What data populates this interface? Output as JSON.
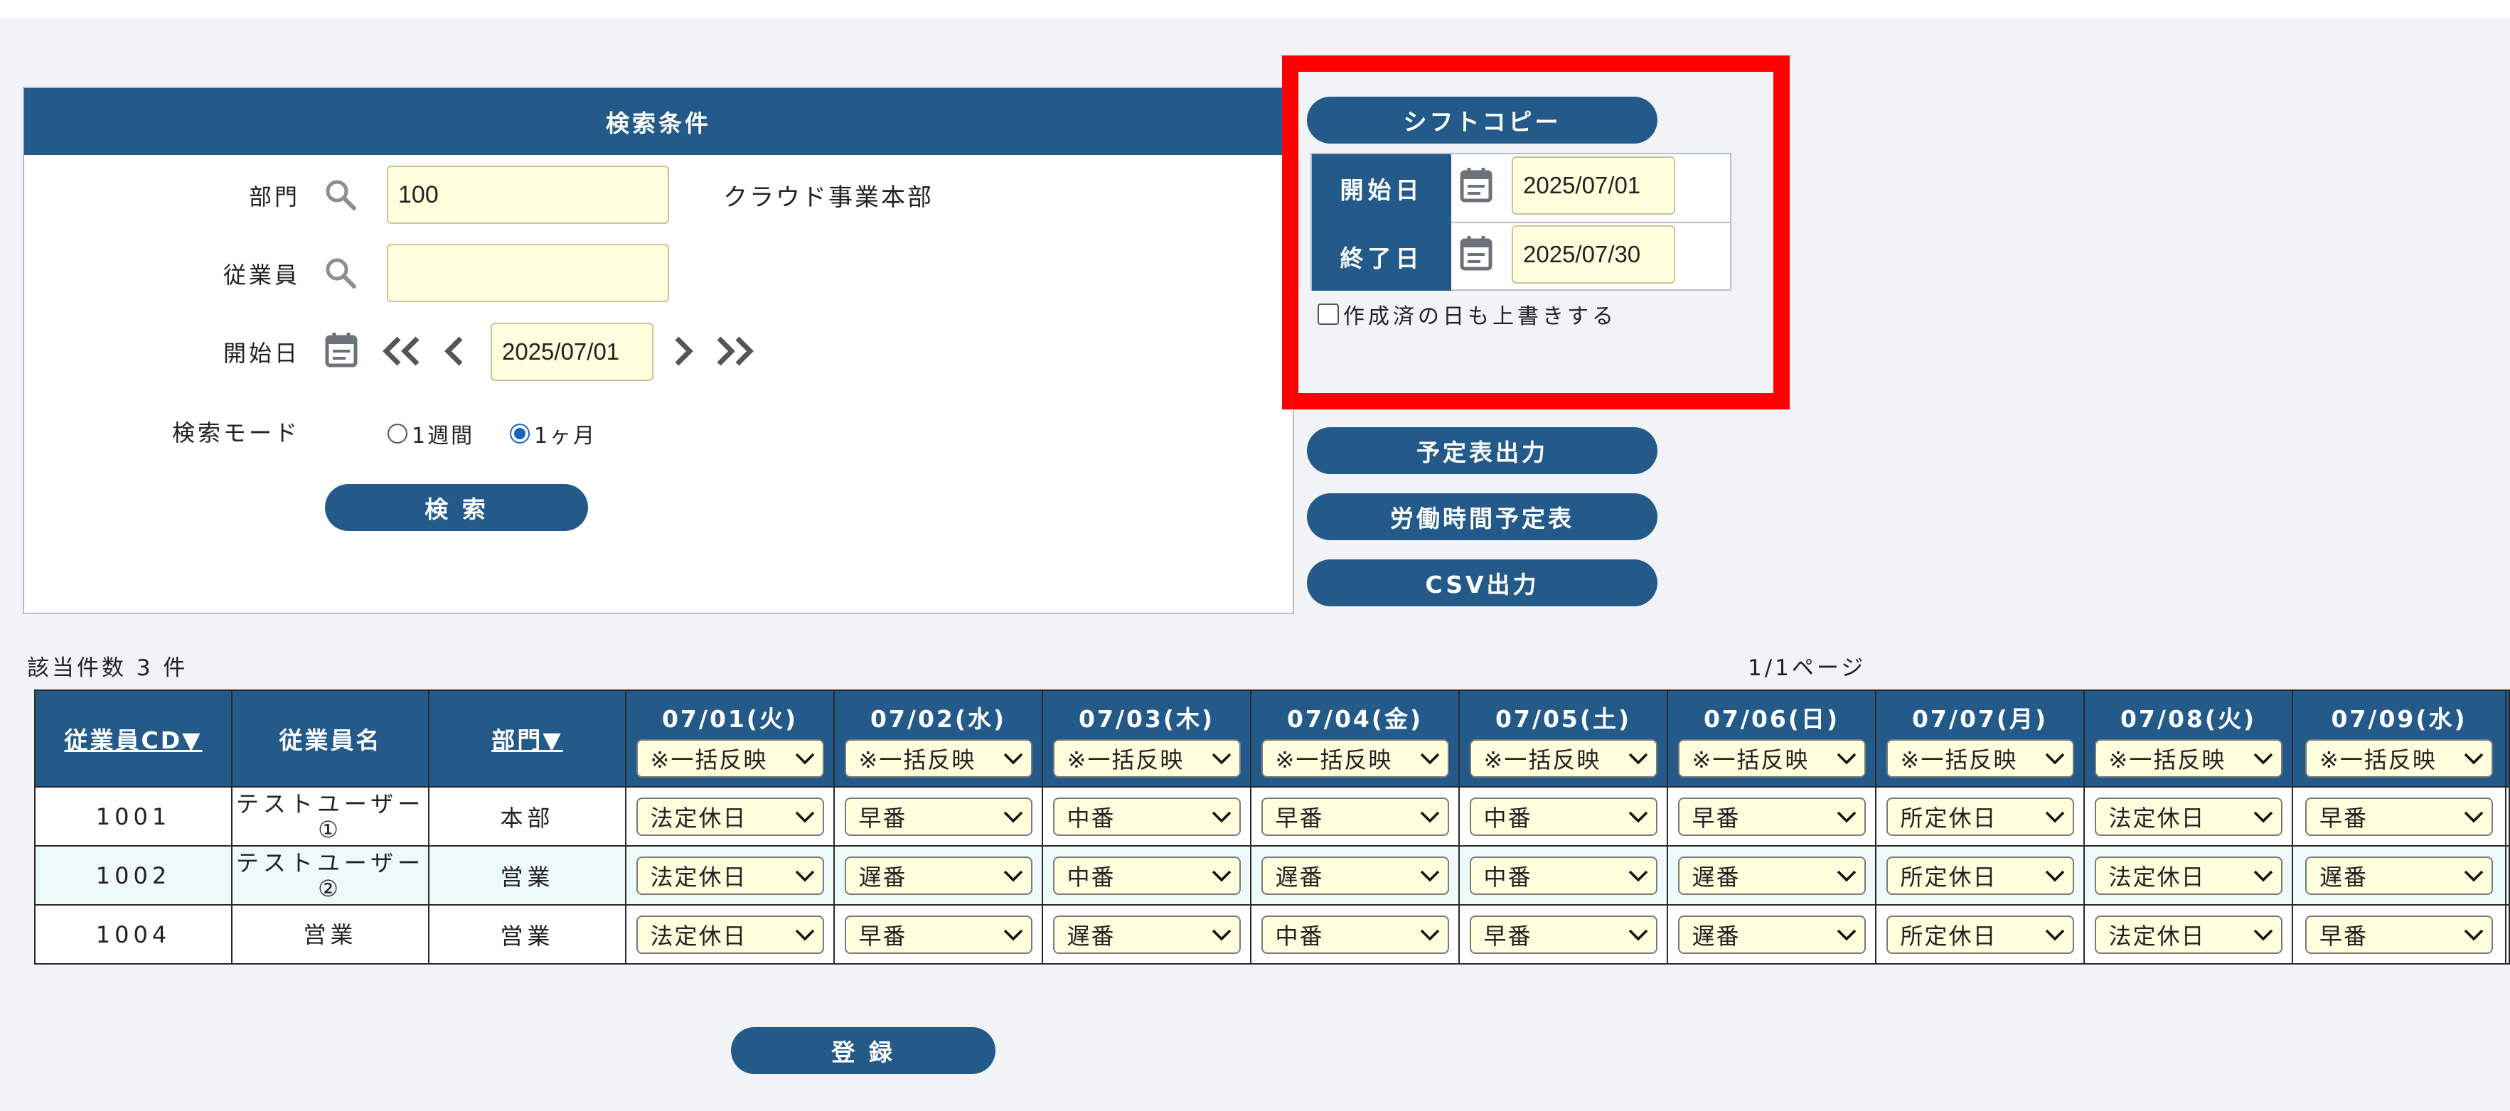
{
  "search": {
    "title": "検索条件",
    "dept_label": "部門",
    "dept_value": "100",
    "dept_name": "クラウド事業本部",
    "emp_label": "従業員",
    "emp_value": "",
    "start_label": "開始日",
    "start_value": "2025/07/01",
    "mode_label": "検索モード",
    "mode_options": [
      "1週間",
      "1ヶ月"
    ],
    "mode_selected": "1ヶ月",
    "search_button": "検 索"
  },
  "shift_copy": {
    "button": "シフトコピー",
    "start_label": "開始日",
    "start_value": "2025/07/01",
    "end_label": "終了日",
    "end_value": "2025/07/30",
    "overwrite_label": "作成済の日も上書きする",
    "overwrite_checked": false
  },
  "actions": {
    "schedule_output": "予定表出力",
    "work_hours_schedule": "労働時間予定表",
    "csv_output": "CSV出力"
  },
  "results": {
    "count_text": "該当件数 3 件",
    "page_text": "1/1ページ"
  },
  "table": {
    "headers": {
      "emp_cd": "従業員CD▼",
      "emp_name": "従業員名",
      "dept": "部門▼"
    },
    "dates": [
      "07/01(火)",
      "07/02(水)",
      "07/03(木)",
      "07/04(金)",
      "07/05(土)",
      "07/06(日)",
      "07/07(月)",
      "07/08(火)",
      "07/09(水)"
    ],
    "bulk_option": "※一括反映",
    "rows": [
      {
        "cd": "1001",
        "name": "テストユーザー①",
        "dept": "本部",
        "shifts": [
          "法定休日",
          "早番",
          "中番",
          "早番",
          "中番",
          "早番",
          "所定休日",
          "法定休日",
          "早番"
        ]
      },
      {
        "cd": "1002",
        "name": "テストユーザー②",
        "dept": "営業",
        "shifts": [
          "法定休日",
          "遅番",
          "中番",
          "遅番",
          "中番",
          "遅番",
          "所定休日",
          "法定休日",
          "遅番"
        ]
      },
      {
        "cd": "1004",
        "name": "営業",
        "dept": "営業",
        "shifts": [
          "法定休日",
          "早番",
          "遅番",
          "中番",
          "早番",
          "遅番",
          "所定休日",
          "法定休日",
          "早番"
        ]
      }
    ]
  },
  "register_button": "登 録",
  "colors": {
    "navy": "#235a89",
    "input_bg": "#ffffdd",
    "highlight_frame": "#ff0000",
    "page_bg": "#f1f3f7"
  }
}
